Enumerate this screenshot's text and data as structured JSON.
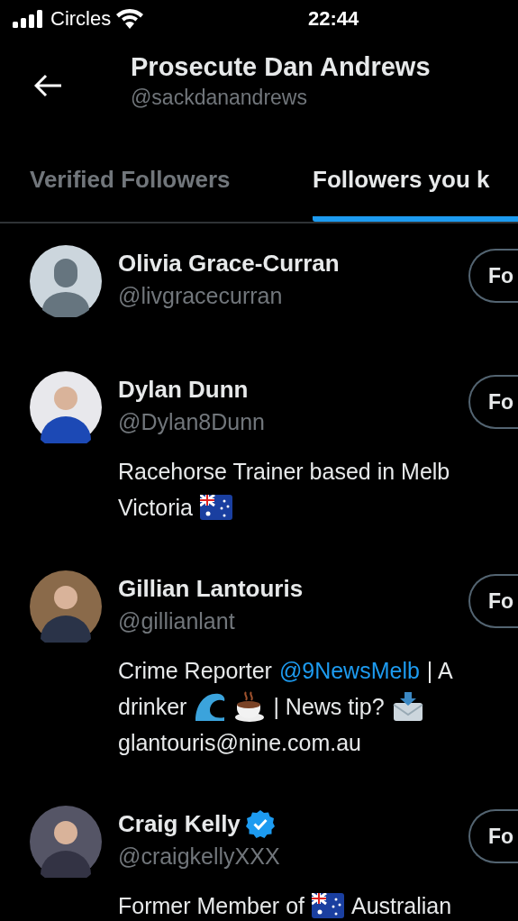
{
  "status_bar": {
    "carrier": "Circles",
    "time": "22:44"
  },
  "header": {
    "title": "Prosecute Dan Andrews",
    "handle": "@sackdanandrews"
  },
  "tabs": [
    {
      "label": "Verified Followers",
      "selected": false
    },
    {
      "label": "Followers you k",
      "selected": true
    }
  ],
  "users": [
    {
      "name": "Olivia Grace-Curran",
      "handle": "@livgracecurran",
      "verified": false,
      "avatar": {
        "kind": "default"
      },
      "button": "Fo"
    },
    {
      "name": "Dylan Dunn",
      "handle": "@Dylan8Dunn",
      "verified": false,
      "avatar": {
        "kind": "picture"
      },
      "button": "Fo",
      "bio": [
        [
          {
            "kind": "text",
            "text": "Racehorse Trainer based in Melb"
          }
        ],
        [
          {
            "kind": "text",
            "text": "Victoria"
          },
          {
            "kind": "flag"
          }
        ]
      ]
    },
    {
      "name": "Gillian Lantouris",
      "handle": "@gillianlant",
      "verified": false,
      "avatar": {
        "kind": "picture"
      },
      "button": "Fo",
      "bio": [
        [
          {
            "kind": "text",
            "text": "Crime Reporter"
          },
          {
            "kind": "link",
            "text": "@9NewsMelb"
          },
          {
            "kind": "text",
            "text": "| A"
          }
        ],
        [
          {
            "kind": "text",
            "text": "drinker"
          },
          {
            "kind": "wave"
          },
          {
            "kind": "cup"
          },
          {
            "kind": "text",
            "text": "| News tip?"
          },
          {
            "kind": "envelope"
          }
        ],
        [
          {
            "kind": "text",
            "text": "glantouris@nine.com.au"
          }
        ]
      ]
    },
    {
      "name": "Craig Kelly",
      "handle": "@craigkellyXXX",
      "verified": true,
      "avatar": {
        "kind": "picture"
      },
      "button": "Fo",
      "bio": [
        [
          {
            "kind": "text",
            "text": "Former Member of"
          },
          {
            "kind": "flag"
          },
          {
            "kind": "text",
            "text": "Australian"
          }
        ]
      ]
    }
  ]
}
